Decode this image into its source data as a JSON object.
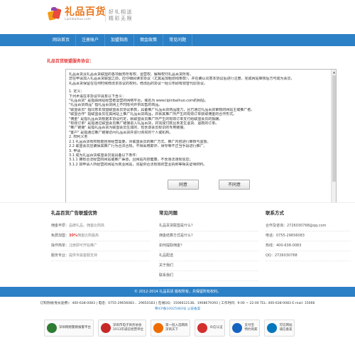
{
  "header": {
    "logo_title": "礼品百货",
    "logo_url": "Lipinbaihuo.com",
    "slogan_line1": "好礼相送",
    "slogan_line2": "精彩无限"
  },
  "nav": {
    "items": [
      "网站首页",
      "注册账户",
      "加盟指南",
      "佣金政策",
      "常见问题"
    ]
  },
  "agreement": {
    "title": "礼品百货联盟服务协议：",
    "paragraphs": [
      "礼品百货及礼品百货联盟的各项服务所有权、运营权、解释权归礼品百货所有。",
      "您在申请加入礼品百货联盟之前，应仔细阅读本协议（尤其是加粗划线条款），并在确认同意本协议后进行注册，完成网站审核后方可成为会员，",
      "礼品百货保留在任何时候修改本协议的权利，修改后的协议一经公布即有效替代原协议。",
      "",
      "1. 定义：",
      "下列术语在本协议中具有以下含义：",
      "\"礼品百货\" 是指由网站经营者运营的网络平台，域名为 www.lipinbaihuo.com的网站。",
      "\"礼品百货商品\" 指礼品百货网上不时陈列并供出售的商品。",
      "\"联盟会员\" 指同意本加盟联盟会员协议条款，具备推广礼品百货商品能力，且已通过礼品百货审核的网站主或推广者。",
      "\"联盟合作\" 指联盟会员在其网站上推广礼品百货商品，并就其推广所产生的有效订单获取佣金的合作形式。",
      "\"佣金\" 是指礼品百货根据本协议约定，就联盟会员推广所产生的有效订单支付给联盟会员的报酬。",
      "\"有效订单\" 是指通过联盟会员推广链接进入礼品百货，并完成付款且未发生退货、退款的订单。",
      "\"推广链接\" 是指礼品百货为联盟会员生成的、包含该会员标识的专用链接。",
      "\"客户\" 是指通过推广链接访问礼品百货并进行购买的个人或机构。",
      "2. 权利义务",
      "2.1 礼品百货有权根据自身经营需要，对联盟会员的推广方式、推广内容进行审核与监督。",
      "2.2 联盟会员应确保其推广行为合法合规，不得采用欺诈、误导等不正当手段进行推广。",
      "3. 申请",
      "3.1 成为礼品百货联盟会员需具备以下条件：",
      "3.1.1 拥有合法经营的网站或推广渠道，且网站内容健康，不含违法违规信息；",
      "3.1.2 如申请人所经营的网站为商业网站，须提供合法有效的营业执照等相关证明材料。"
    ]
  },
  "buttons": {
    "agree": "同意",
    "disagree": "不同意"
  },
  "footer": {
    "col1": {
      "title": "礼品百货广告联盟优势",
      "rows": [
        {
          "label": "佣金丰厚：",
          "value": "品牌礼品，佣金比例高"
        },
        {
          "label": "免费加盟：",
          "highlight": "30%",
          "value": "佣金比例最高"
        },
        {
          "label": "操作简单：",
          "value": "注册即可开始推广"
        },
        {
          "label": "服务专业：",
          "value": "提供专属客服支持"
        }
      ]
    },
    "col2": {
      "title": "常见问题",
      "rows": [
        "礼品百货联盟是什么？",
        "佣金结算方式是什么？",
        "如何提取佣金？",
        "礼品配送",
        "关于我们",
        "联系我们"
      ]
    },
    "col3": {
      "title": "联系方式",
      "rows": [
        "合作及咨询：2726030768@qq.com",
        "电话：0755-29656083",
        "热线：400-638-0083",
        "QQ：2726030768"
      ]
    }
  },
  "copyright": "© 2012-2014 礼品百货 版权所有，并保留所有权利。",
  "contact_line1": "订购热线(免长途费)：400-638-0083 | 电话：0755-29656083 、29650183 | 在线QQ：1506612138、1908679393 | 工作时间：9:00 ~ 22:00 TEL: 400-638-0083 E-mail: 15066",
  "contact_line2": "粤ICP备10025083号 公安备案",
  "badges": [
    {
      "name": "深圳网络警察报警平台",
      "color": "#2e7d32"
    },
    {
      "name": "深圳市电子商务协会\n2013年诚信经营单位",
      "color": "#c62828"
    },
    {
      "name": "第一批入选网商\n深商天下",
      "color": "#ef6c00"
    },
    {
      "name": "众信认证",
      "color": "#d32f2f"
    },
    {
      "name": "支付宝\n特约商家",
      "color": "#1565c0"
    },
    {
      "name": "可信网站\n诚信备案",
      "color": "#0277bd"
    }
  ]
}
